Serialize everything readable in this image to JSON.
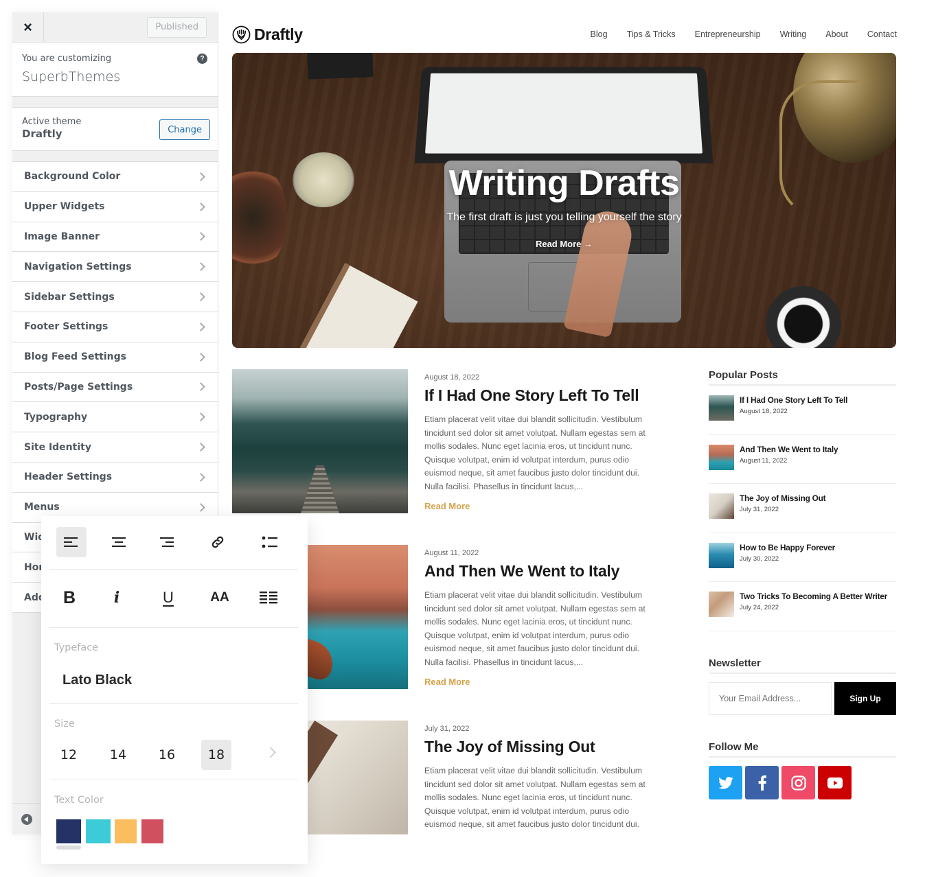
{
  "customizer": {
    "close_label": "×",
    "publish_label": "Published",
    "customizing_label": "You are customizing",
    "site_name": "SuperbThemes",
    "help_label": "?",
    "active_theme_label": "Active theme",
    "active_theme_name": "Draftly",
    "change_label": "Change",
    "sections": [
      {
        "label": "Background Color"
      },
      {
        "label": "Upper Widgets"
      },
      {
        "label": "Image Banner"
      },
      {
        "label": "Navigation Settings"
      },
      {
        "label": "Sidebar Settings"
      },
      {
        "label": "Footer Settings"
      },
      {
        "label": "Blog Feed Settings"
      },
      {
        "label": "Posts/Page Settings"
      },
      {
        "label": "Typography"
      },
      {
        "label": "Site Identity"
      },
      {
        "label": "Header Settings"
      },
      {
        "label": "Menus"
      },
      {
        "label": "Widgets"
      },
      {
        "label": "Homepage Settings"
      },
      {
        "label": "Additional CSS"
      }
    ]
  },
  "site": {
    "logo_text": "Draftly",
    "nav": [
      "Blog",
      "Tips & Tricks",
      "Entrepreneurship",
      "Writing",
      "About",
      "Contact"
    ],
    "hero": {
      "title": "Writing Drafts",
      "subtitle": "The first draft is just you telling yourself the story",
      "cta": "Read More →"
    },
    "posts": [
      {
        "date": "August 18, 2022",
        "title": "If I Had One Story Left To Tell",
        "excerpt": "Etiam placerat velit vitae dui blandit sollicitudin. Vestibulum tincidunt sed dolor sit amet volutpat. Nullam egestas sem at mollis sodales. Nunc eget lacinia eros, ut tincidunt nunc. Quisque volutpat, enim id volutpat interdum, purus odio euismod neque, sit amet faucibus justo dolor tincidunt dui. Nulla facilisi. Phasellus in tincidunt lacus,...",
        "read_more": "Read More"
      },
      {
        "date": "August 11, 2022",
        "title": "And Then We Went to Italy",
        "excerpt": "Etiam placerat velit vitae dui blandit sollicitudin. Vestibulum tincidunt sed dolor sit amet volutpat. Nullam egestas sem at mollis sodales. Nunc eget lacinia eros, ut tincidunt nunc. Quisque volutpat, enim id volutpat interdum, purus odio euismod neque, sit amet faucibus justo dolor tincidunt dui. Nulla facilisi. Phasellus in tincidunt lacus,...",
        "read_more": "Read More"
      },
      {
        "date": "July 31, 2022",
        "title": "The Joy of Missing Out",
        "excerpt": "Etiam placerat velit vitae dui blandit sollicitudin. Vestibulum tincidunt sed dolor sit amet volutpat. Nullam egestas sem at mollis sodales. Nunc eget lacinia eros, ut tincidunt nunc. Quisque volutpat, enim id volutpat interdum, purus odio euismod neque, sit amet faucibus justo dolor tincidunt dui.",
        "read_more": ""
      }
    ],
    "popular_posts": {
      "title": "Popular Posts",
      "items": [
        {
          "title": "If I Had One Story Left To Tell",
          "date": "August 18, 2022"
        },
        {
          "title": "And Then We Went to Italy",
          "date": "August 11, 2022"
        },
        {
          "title": "The Joy of Missing Out",
          "date": "July 31, 2022"
        },
        {
          "title": "How to Be Happy Forever",
          "date": "July 30, 2022"
        },
        {
          "title": "Two Tricks To Becoming A Better Writer",
          "date": "July 24, 2022"
        }
      ]
    },
    "newsletter": {
      "title": "Newsletter",
      "placeholder": "Your Email Address...",
      "button": "Sign Up"
    },
    "follow": {
      "title": "Follow Me",
      "networks": [
        {
          "name": "twitter",
          "color": "#1da1f2"
        },
        {
          "name": "facebook",
          "color": "#3b5998"
        },
        {
          "name": "instagram",
          "color": "#ef4a67"
        },
        {
          "name": "youtube",
          "color": "#cc0000"
        }
      ]
    },
    "accent_color": "#d4a24a"
  },
  "toolbar": {
    "align_buttons": [
      "align-left",
      "align-center",
      "align-right",
      "link",
      "list"
    ],
    "active_align": "align-left",
    "format_buttons": {
      "bold": "B",
      "italic": "i",
      "underline": "U",
      "caps": "AA",
      "justify": "≣"
    },
    "typeface_label": "Typeface",
    "typeface_value": "Lato Black",
    "size_label": "Size",
    "sizes": [
      "12",
      "14",
      "16",
      "18"
    ],
    "active_size": "18",
    "text_color_label": "Text Color",
    "colors": [
      "#243265",
      "#3ecbd8",
      "#fcbd5e",
      "#d05060"
    ],
    "active_color_index": 0
  }
}
